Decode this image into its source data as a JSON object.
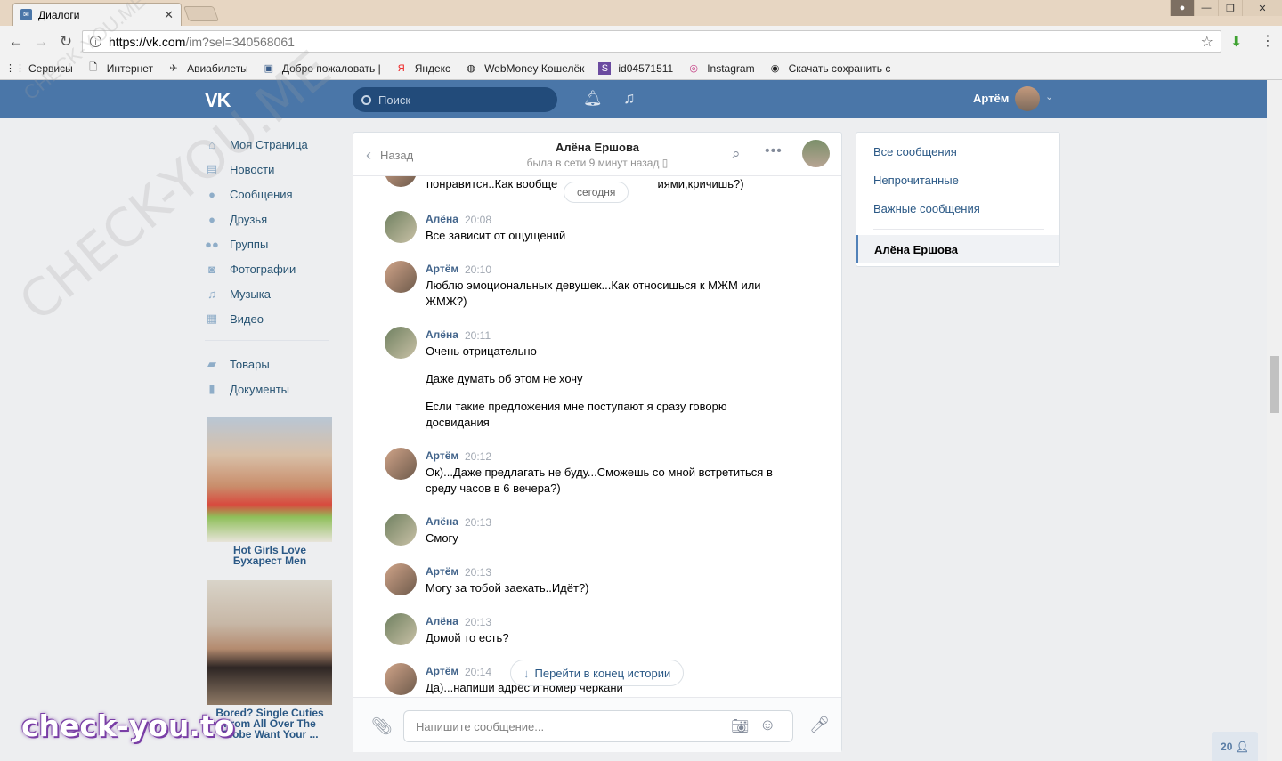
{
  "browser": {
    "tab_title": "Диалоги",
    "url_host": "https://vk.com",
    "url_path": "/im?sel=340568061",
    "bookmarks": [
      {
        "label": "Сервисы",
        "icon": "apps-grid-icon"
      },
      {
        "label": "Интернет",
        "icon": "page-icon"
      },
      {
        "label": "Авиабилеты",
        "icon": "plane-icon"
      },
      {
        "label": "Добро пожаловать |",
        "icon": "chat-icon"
      },
      {
        "label": "Яндекс",
        "icon": "yandex-icon"
      },
      {
        "label": "WebMoney Кошелёк",
        "icon": "globe-icon"
      },
      {
        "label": "id04571511",
        "icon": "s-icon"
      },
      {
        "label": "Instagram",
        "icon": "instagram-icon"
      },
      {
        "label": "Скачать сохранить с",
        "icon": "eye-icon"
      }
    ]
  },
  "vk": {
    "search_placeholder": "Поиск",
    "user_name": "Артём"
  },
  "left_menu": {
    "items": [
      {
        "label": "Моя Страница",
        "icon": "home-icon"
      },
      {
        "label": "Новости",
        "icon": "news-icon"
      },
      {
        "label": "Сообщения",
        "icon": "messages-icon"
      },
      {
        "label": "Друзья",
        "icon": "friend-icon"
      },
      {
        "label": "Группы",
        "icon": "groups-icon"
      },
      {
        "label": "Фотографии",
        "icon": "camera-icon"
      },
      {
        "label": "Музыка",
        "icon": "music-icon"
      },
      {
        "label": "Видео",
        "icon": "video-icon"
      }
    ],
    "items2": [
      {
        "label": "Товары",
        "icon": "bag-icon"
      },
      {
        "label": "Документы",
        "icon": "document-icon"
      }
    ]
  },
  "ads": [
    {
      "title": "Hot Girls Love Бухарест Men"
    },
    {
      "title": "Bored? Single Cuties From All Over The Globe Want Your ..."
    }
  ],
  "dialog": {
    "back_label": "Назад",
    "peer_name": "Алёна Ершова",
    "peer_status": "была в сети 9 минут назад",
    "cut_text_left": "понравится..Как вообще",
    "cut_text_right": "иями,кричишь?)",
    "date_divider": "сегодня",
    "goto_end": "Перейти в конец истории",
    "input_placeholder": "Напишите сообщение...",
    "messages": [
      {
        "author": "Алёна",
        "time": "20:08",
        "lines": [
          "Все зависит от ощущений"
        ]
      },
      {
        "author": "Артём",
        "time": "20:10",
        "lines": [
          "Люблю эмоциональных девушек...Как относишься к МЖМ или ЖМЖ?)"
        ]
      },
      {
        "author": "Алёна",
        "time": "20:11",
        "lines": [
          "Очень отрицательно",
          "Даже думать об этом не хочу",
          "Если такие предложения мне поступают я сразу говорю досвидания"
        ]
      },
      {
        "author": "Артём",
        "time": "20:12",
        "lines": [
          "Ок)...Даже предлагать не буду...Сможешь со мной встретиться в среду часов в 6 вечера?)"
        ]
      },
      {
        "author": "Алёна",
        "time": "20:13",
        "lines": [
          "Смогу"
        ]
      },
      {
        "author": "Артём",
        "time": "20:13",
        "lines": [
          "Могу за тобой заехать..Идёт?)"
        ]
      },
      {
        "author": "Алёна",
        "time": "20:13",
        "lines": [
          "Домой то есть?"
        ]
      },
      {
        "author": "Артём",
        "time": "20:14",
        "lines": [
          "Да)...напиши адрес и номер черкани"
        ]
      }
    ]
  },
  "filters": {
    "all": "Все сообщения",
    "unread": "Непрочитанные",
    "important": "Важные сообщения",
    "active_chat": "Алёна Ершова"
  },
  "online_badge": "20",
  "watermark": {
    "diagonal": "CHECK-YOU.ME",
    "bottom": "check-you.to"
  },
  "colors": {
    "vk_blue": "#4a76a8",
    "link": "#2a5885",
    "author": "#42648b"
  }
}
